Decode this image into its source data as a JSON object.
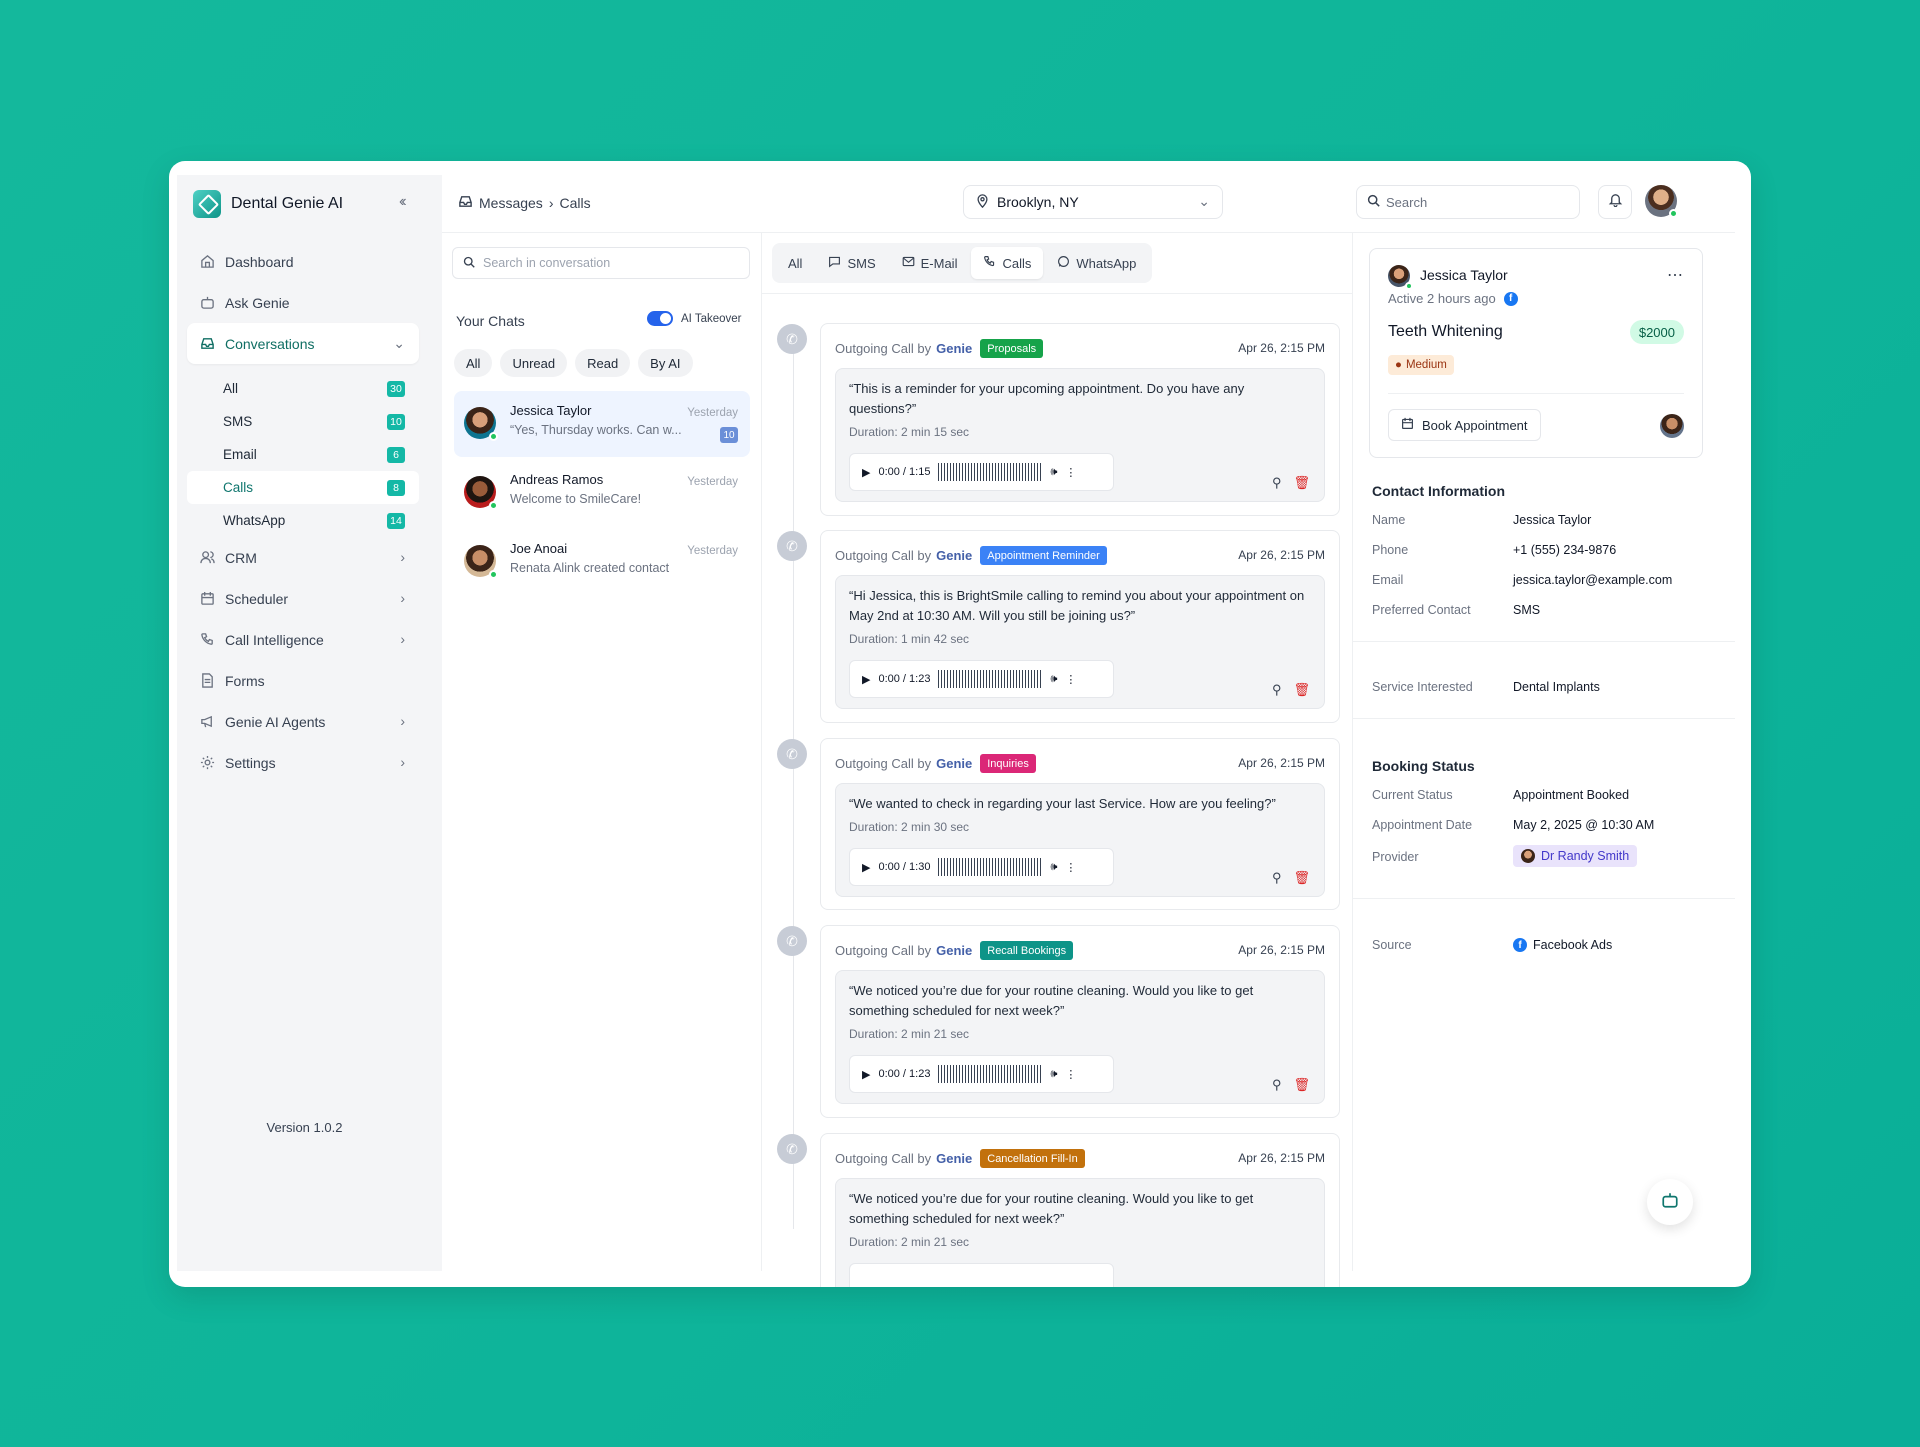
{
  "app": {
    "name": "Dental Genie AI",
    "version": "Version 1.0.2"
  },
  "sidebar": {
    "items": [
      {
        "label": "Dashboard",
        "icon": "home-icon"
      },
      {
        "label": "Ask Genie",
        "icon": "bot-icon"
      },
      {
        "label": "Conversations",
        "icon": "inbox-icon"
      },
      {
        "label": "CRM",
        "icon": "users-icon"
      },
      {
        "label": "Scheduler",
        "icon": "calendar-icon"
      },
      {
        "label": "Call Intelligence",
        "icon": "phone-icon"
      },
      {
        "label": "Forms",
        "icon": "file-icon"
      },
      {
        "label": "Genie AI Agents",
        "icon": "megaphone-icon"
      },
      {
        "label": "Settings",
        "icon": "gear-icon"
      }
    ],
    "sub": [
      {
        "label": "All",
        "count": "30"
      },
      {
        "label": "SMS",
        "count": "10"
      },
      {
        "label": "Email",
        "count": "6"
      },
      {
        "label": "Calls",
        "count": "8"
      },
      {
        "label": "WhatsApp",
        "count": "14"
      }
    ]
  },
  "header": {
    "breadcrumb": [
      "Messages",
      "Calls"
    ],
    "location": "Brooklyn, NY",
    "search_placeholder": "Search"
  },
  "chats": {
    "search_placeholder": "Search in conversation",
    "title": "Your Chats",
    "ai_takeover": "AI Takeover",
    "filters": [
      "All",
      "Unread",
      "Read",
      "By AI"
    ],
    "list": [
      {
        "name": "Jessica Taylor",
        "preview": "“Yes, Thursday works. Can w...",
        "time": "Yesterday",
        "count": "10"
      },
      {
        "name": "Andreas Ramos",
        "preview": "Welcome to SmileCare!",
        "time": "Yesterday"
      },
      {
        "name": "Joe Anoai",
        "preview": "Renata Alink created contact",
        "time": "Yesterday"
      }
    ]
  },
  "channels": [
    "All",
    "SMS",
    "E-Mail",
    "Calls",
    "WhatsApp"
  ],
  "calls": [
    {
      "prefix": "Outgoing Call by",
      "by": "Genie",
      "tag": "Proposals",
      "tag_color": "#16a34a",
      "time": "Apr 26, 2:15 PM",
      "quote": "“This is a reminder for your upcoming appointment. Do you have any questions?”",
      "duration": "Duration: 2 min 15 sec",
      "player": "0:00 / 1:15"
    },
    {
      "prefix": "Outgoing Call by",
      "by": "Genie",
      "tag": "Appointment Reminder",
      "tag_color": "#3b82f6",
      "time": "Apr 26, 2:15 PM",
      "quote": "“Hi Jessica, this is BrightSmile calling to remind you about your appointment on May 2nd at 10:30 AM. Will you still be joining us?”",
      "duration": "Duration: 1 min 42 sec",
      "player": "0:00 / 1:23"
    },
    {
      "prefix": "Outgoing Call by",
      "by": "Genie",
      "tag": "Inquiries",
      "tag_color": "#db2777",
      "time": "Apr 26, 2:15 PM",
      "quote": "“We wanted to check in regarding your last Service. How are you feeling?”",
      "duration": "Duration: 2 min 30 sec",
      "player": "0:00 / 1:30"
    },
    {
      "prefix": "Outgoing Call by",
      "by": "Genie",
      "tag": "Recall Bookings",
      "tag_color": "#0d9488",
      "time": "Apr 26, 2:15 PM",
      "quote": "“We noticed you’re due for your routine cleaning. Would you like to get something scheduled for next week?”",
      "duration": "Duration: 2 min 21 sec",
      "player": "0:00 / 1:23"
    },
    {
      "prefix": "Outgoing Call by",
      "by": "Genie",
      "tag": "Cancellation Fill-In",
      "tag_color": "#c2710c",
      "time": "Apr 26, 2:15 PM",
      "quote": "“We noticed you’re due for your routine cleaning. Would you like to get something scheduled for next week?”",
      "duration": "Duration: 2 min 21 sec",
      "player": ""
    }
  ],
  "profile": {
    "name": "Jessica Taylor",
    "active": "Active 2 hours ago",
    "service": "Teeth Whitening",
    "price": "$2000",
    "priority": "Medium",
    "book_label": "Book Appointment",
    "contact_title": "Contact Information",
    "contact": [
      {
        "label": "Name",
        "value": "Jessica Taylor"
      },
      {
        "label": "Phone",
        "value": "+1 (555) 234-9876"
      },
      {
        "label": "Email",
        "value": "jessica.taylor@example.com"
      },
      {
        "label": "Preferred Contact",
        "value": "SMS"
      }
    ],
    "service_label": "Service Interested",
    "service_value": "Dental Implants",
    "booking_title": "Booking Status",
    "booking": [
      {
        "label": "Current Status",
        "value": "Appointment Booked"
      },
      {
        "label": "Appointment Date",
        "value": "May 2, 2025 @ 10:30 AM"
      },
      {
        "label": "Provider",
        "value": "Dr Randy Smith"
      }
    ],
    "source_label": "Source",
    "source_value": "Facebook Ads"
  }
}
